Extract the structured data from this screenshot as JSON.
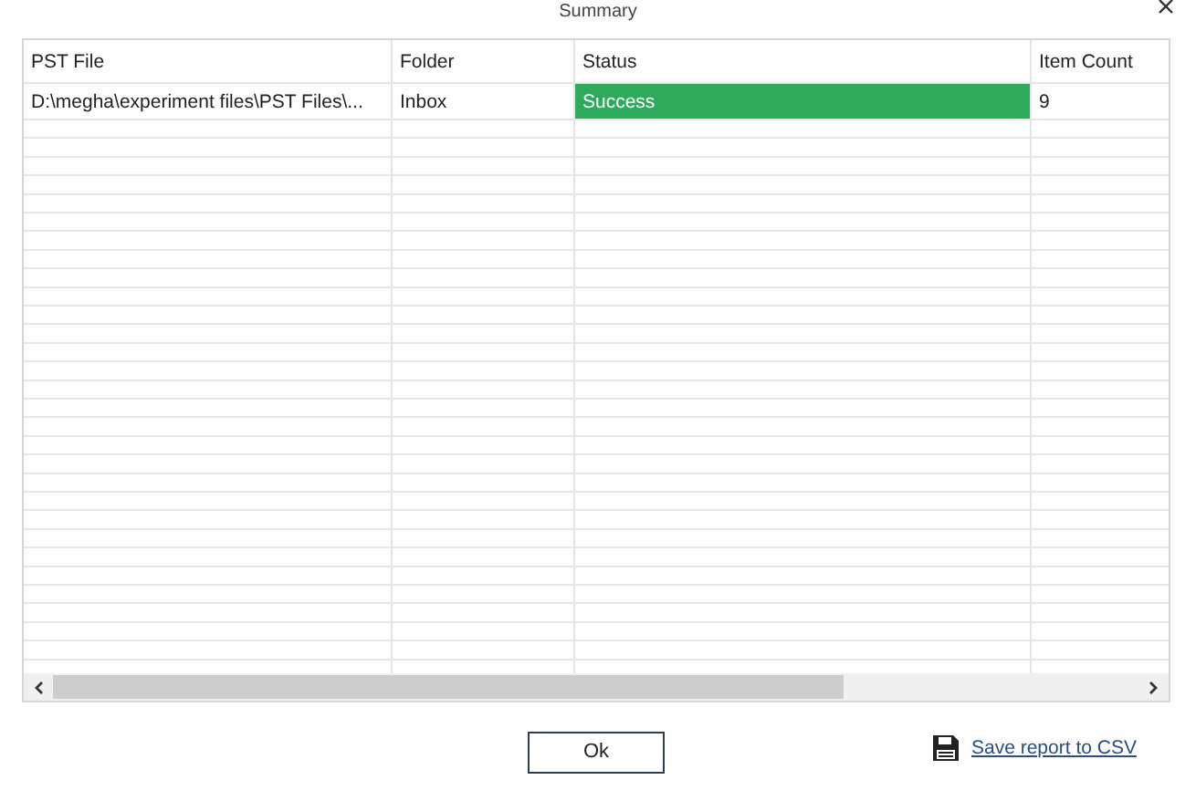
{
  "window": {
    "title": "Summary"
  },
  "table": {
    "columns": [
      "PST File",
      "Folder",
      "Status",
      "Item Count"
    ],
    "rows": [
      {
        "pst_file": "D:\\megha\\experiment files\\PST Files\\...",
        "folder": "Inbox",
        "status": "Success",
        "color": "#2eaa5c",
        "item_count": "9"
      }
    ]
  },
  "buttons": {
    "ok": "Ok",
    "save_link": "Save report to CSV"
  }
}
